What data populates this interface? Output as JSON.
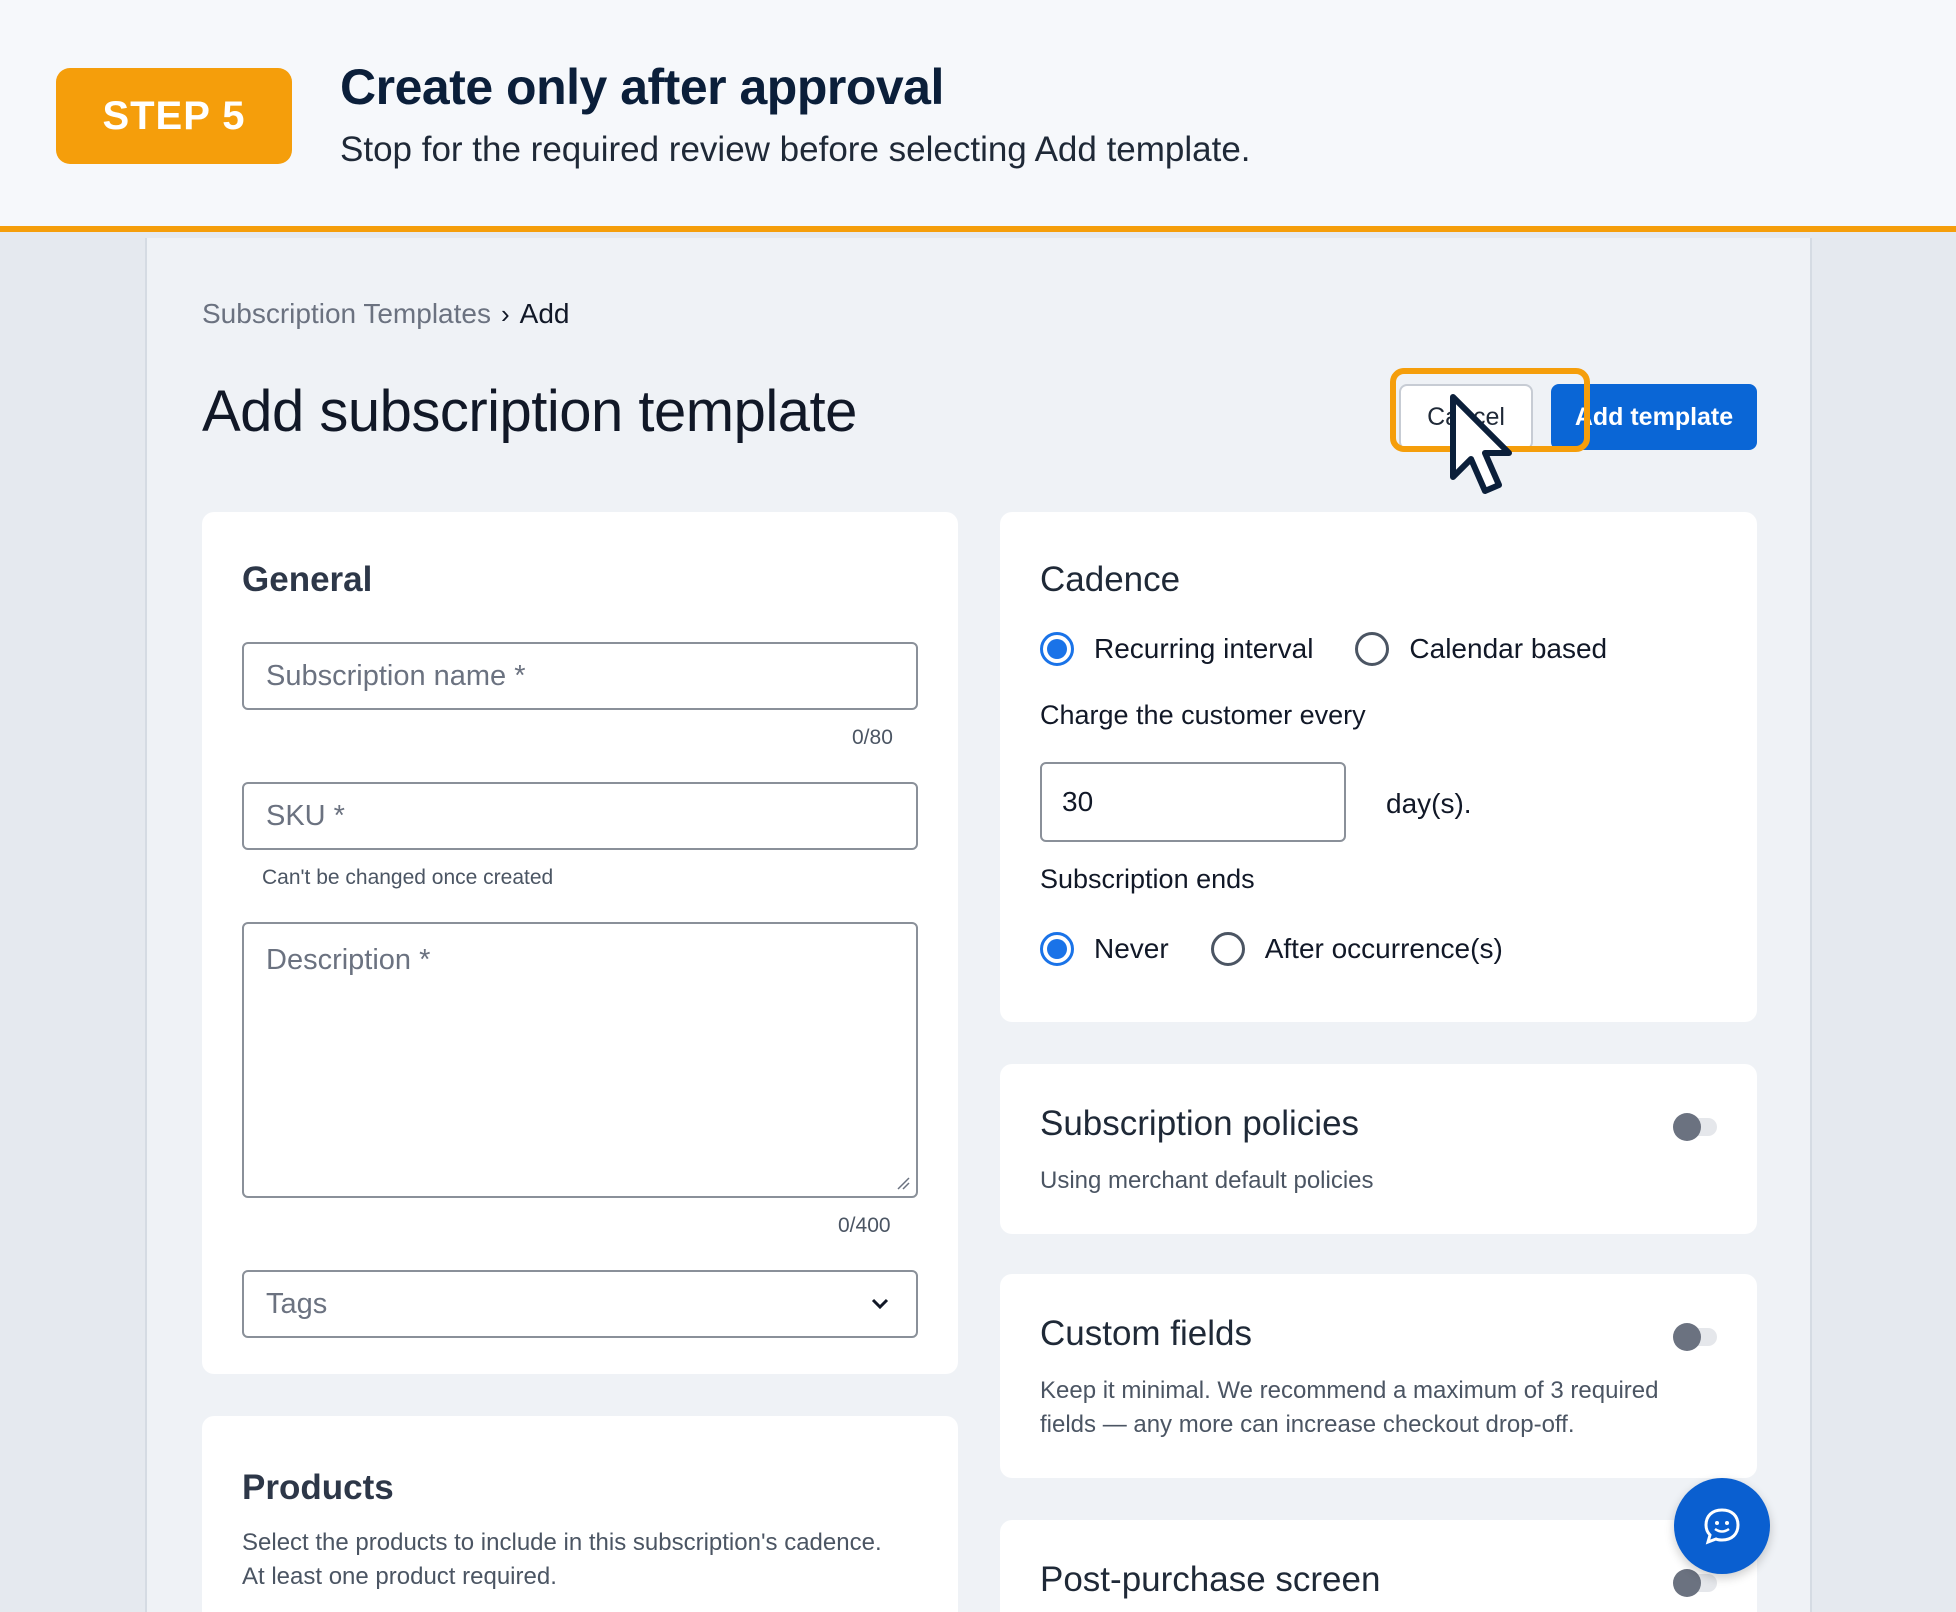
{
  "banner": {
    "step": "STEP 5",
    "title": "Create only after approval",
    "subtitle": "Stop for the required review before selecting Add template."
  },
  "breadcrumb": {
    "parent": "Subscription Templates",
    "current": "Add"
  },
  "page": {
    "title": "Add subscription template"
  },
  "actions": {
    "cancel": "Cancel",
    "add": "Add template"
  },
  "general": {
    "title": "General",
    "name_placeholder": "Subscription name *",
    "name_counter": "0/80",
    "sku_placeholder": "SKU *",
    "sku_helper": "Can't be changed once created",
    "desc_placeholder": "Description *",
    "desc_counter": "0/400",
    "tags_placeholder": "Tags"
  },
  "products": {
    "title": "Products",
    "description": "Select the products to include in this subscription's cadence. At least one product required."
  },
  "cadence": {
    "title": "Cadence",
    "type_options": [
      "Recurring interval",
      "Calendar based"
    ],
    "type_selected": "Recurring interval",
    "charge_label": "Charge the customer every",
    "interval_value": "30",
    "interval_unit": "day(s).",
    "ends_label": "Subscription ends",
    "ends_options": [
      "Never",
      "After occurrence(s)"
    ],
    "ends_selected": "Never"
  },
  "policies": {
    "title": "Subscription policies",
    "subtitle": "Using merchant default policies",
    "enabled": false
  },
  "custom_fields": {
    "title": "Custom fields",
    "subtitle": "Keep it minimal. We recommend a maximum of 3 required fields — any more can increase checkout drop-off.",
    "enabled": false
  },
  "post_purchase": {
    "title": "Post-purchase screen",
    "enabled": false
  },
  "colors": {
    "accent": "#f59e0b",
    "primary": "#0a66d6"
  }
}
